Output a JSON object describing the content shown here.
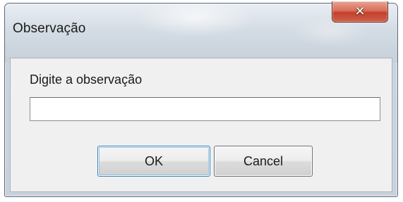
{
  "dialog": {
    "title": "Observação",
    "close_icon": "close-icon",
    "prompt": "Digite a observação",
    "input_value": "",
    "ok_label": "OK",
    "cancel_label": "Cancel"
  }
}
